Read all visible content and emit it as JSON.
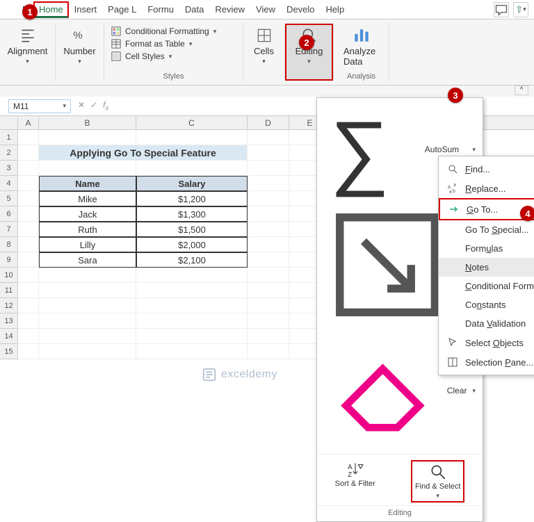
{
  "tabs": {
    "items": [
      "F",
      "Home",
      "Insert",
      "Page L",
      "Formu",
      "Data",
      "Review",
      "View",
      "Develo",
      "Help"
    ],
    "active_index": 1
  },
  "ribbon": {
    "alignment": "Alignment",
    "number": "Number",
    "cond_format": "Conditional Formatting",
    "format_table": "Format as Table",
    "cell_styles": "Cell Styles",
    "styles_label": "Styles",
    "cells": "Cells",
    "editing": "Editing",
    "analyze": "Analyze Data",
    "analysis_label": "Analysis"
  },
  "name_box": "M11",
  "dropdown": {
    "autosum": "AutoSum",
    "fill": "Fill",
    "clear": "Clear",
    "sort_filter": "Sort & Filter",
    "find_select": "Find & Select",
    "group_label": "Editing"
  },
  "menu": {
    "find": "Find...",
    "replace": "Replace...",
    "goto": "Go To...",
    "goto_special": "Go To Special...",
    "formulas": "Formulas",
    "notes": "Notes",
    "cond_format": "Conditional Form",
    "constants": "Constants",
    "data_validation": "Data Validation",
    "select_objects": "Select Objects",
    "selection_pane": "Selection Pane..."
  },
  "sheet": {
    "title": "Applying Go To Special Feature",
    "headers": {
      "name": "Name",
      "salary": "Salary"
    },
    "rows": [
      {
        "name": "Mike",
        "salary": "$1,200"
      },
      {
        "name": "Jack",
        "salary": "$1,300"
      },
      {
        "name": "Ruth",
        "salary": "$1,500"
      },
      {
        "name": "Lilly",
        "salary": "$2,000"
      },
      {
        "name": "Sara",
        "salary": "$2,100"
      }
    ]
  },
  "steps": {
    "s1": "1",
    "s2": "2",
    "s3": "3",
    "s4": "4"
  },
  "watermark": "exceldemy",
  "columns": [
    "A",
    "B",
    "C",
    "D",
    "E"
  ]
}
